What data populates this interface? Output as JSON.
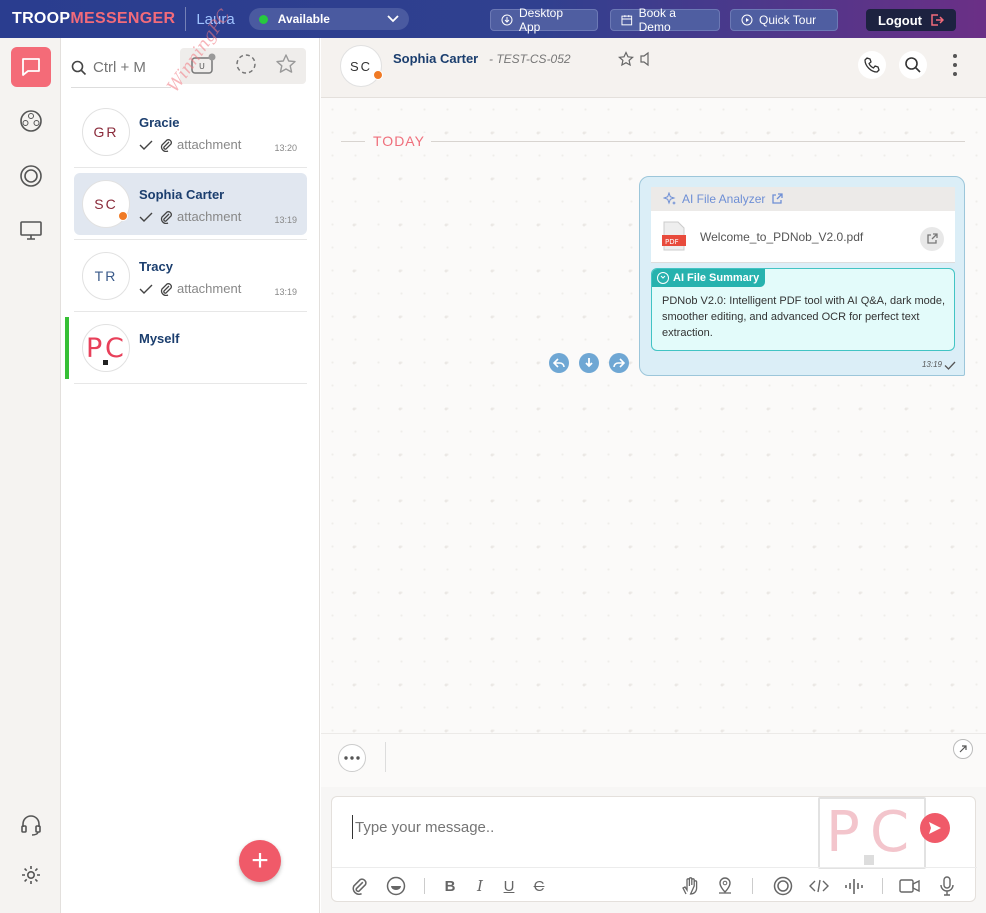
{
  "topbar": {
    "brand_part1": "TROOP",
    "brand_part2": "MESSENGER",
    "username": "Laura",
    "status": "Available",
    "buttons": {
      "desktop_app": "Desktop App",
      "book_demo": "Book a Demo",
      "quick_tour": "Quick Tour"
    },
    "logout": "Logout"
  },
  "watermark": "WinningPC",
  "search": {
    "placeholder": "Ctrl + M"
  },
  "contacts": [
    {
      "initials": "GR",
      "name": "Gracie",
      "preview": "attachment",
      "time": "13:20"
    },
    {
      "initials": "SC",
      "name": "Sophia Carter",
      "preview": "attachment",
      "time": "13:19"
    },
    {
      "initials": "TR",
      "name": "Tracy",
      "preview": "attachment",
      "time": "13:19"
    },
    {
      "initials": "PC",
      "name": "Myself",
      "preview": "",
      "time": ""
    }
  ],
  "chat": {
    "header": {
      "initials": "SC",
      "name": "Sophia Carter",
      "subtitle": "- TEST-CS-052"
    },
    "date_separator": "TODAY",
    "message": {
      "analyzer_label": "AI File Analyzer",
      "file_name": "Welcome_to_PDNob_V2.0.pdf",
      "file_badge": "PDF",
      "summary_label": "AI File Summary",
      "summary_text": "PDNob V2.0: Intelligent PDF tool with AI Q&A, dark mode, smoother editing, and advanced OCR for perfect text extraction.",
      "time": "13:19"
    },
    "composer": {
      "placeholder": "Type your message.."
    }
  },
  "colors": {
    "accent": "#f05a69",
    "topbar_start": "#2a3d8f",
    "topbar_end": "#6b2f86",
    "online": "#27c93f",
    "away": "#f07a25",
    "selected_row": "#e1e7f0"
  }
}
